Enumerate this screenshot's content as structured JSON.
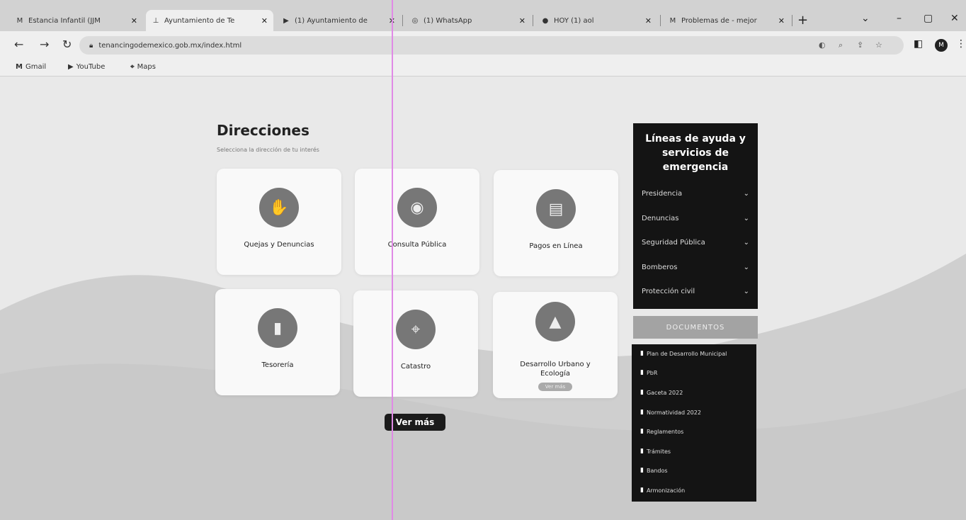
{
  "browser": {
    "tabs": [
      {
        "label": "Estancia Infantil (JJM ",
        "icon": "M",
        "active": false
      },
      {
        "label": "Ayuntamiento de Te",
        "icon": "⊥",
        "active": true
      },
      {
        "label": "(1) Ayuntamiento de",
        "icon": "▶",
        "active": false
      },
      {
        "label": "(1) WhatsApp",
        "icon": "◎",
        "active": false
      },
      {
        "label": "HOY (1) aol",
        "icon": "●",
        "active": false
      },
      {
        "label": "Problemas de - mejor",
        "icon": "M",
        "active": false
      }
    ],
    "new_tab": "+",
    "window_controls": {
      "dropdown": "⌄",
      "minimize": "–",
      "maximize": "▢",
      "close": "✕"
    },
    "url": "tenancingodemexico.gob.mx/index.html",
    "avatar_letter": "M",
    "bookmarks": [
      {
        "label": "Gmail",
        "icon": "M"
      },
      {
        "label": "YouTube",
        "icon": "▶"
      },
      {
        "label": "Maps",
        "icon": "⌖"
      }
    ]
  },
  "page": {
    "title": "Direcciones",
    "subtitle": "Selecciona la dirección de tu interés",
    "cards": [
      {
        "label": "Quejas y Denuncias",
        "icon": "✋",
        "tag": ""
      },
      {
        "label": "Consulta Pública",
        "icon": "◉",
        "tag": ""
      },
      {
        "label": "Pagos en Línea",
        "icon": "▤",
        "tag": ""
      },
      {
        "label": "Tesorería",
        "icon": "▮",
        "tag": ""
      },
      {
        "label": "Catastro",
        "icon": "⌖",
        "tag": ""
      },
      {
        "label": "Desarrollo Urbano y Ecología",
        "icon": "▲",
        "tag": "Ver más"
      }
    ],
    "ver_mas": "Ver más",
    "help": {
      "title_lines": [
        "Líneas de ayuda y",
        "servicios de",
        "emergencia"
      ],
      "items": [
        "Presidencia",
        "Denuncias",
        "Seguridad Pública",
        "Bomberos",
        "Protección civil"
      ],
      "chevron": "⌄"
    },
    "documents_button": "DOCUMENTOS",
    "documents": [
      "Plan de Desarrollo Municipal",
      "PbR",
      "Gaceta 2022",
      "Normatividad 2022",
      "Reglamentos",
      "Trámites",
      "Bandos",
      "Armonización"
    ]
  }
}
